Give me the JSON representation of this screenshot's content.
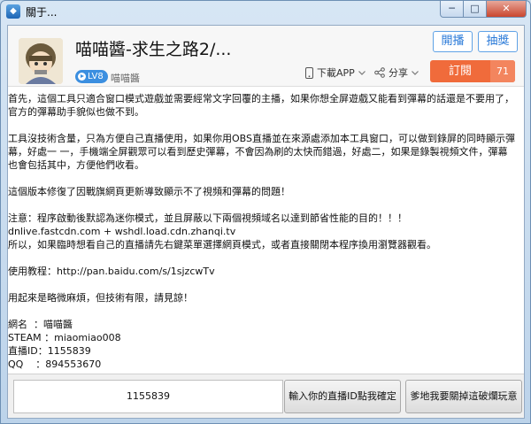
{
  "window": {
    "title": "關于...",
    "minimize_glyph": "─",
    "maximize_glyph": "□",
    "close_glyph": "✕"
  },
  "header": {
    "stream_title": "喵喵醬-求生之路2/...",
    "level_badge": "LV8",
    "streamer_name": "喵喵醬",
    "start_broadcast_label": "開播",
    "lottery_label": "抽獎",
    "download_app_label": "下載APP",
    "share_label": "分享",
    "subscribe_label": "訂閱",
    "subscribe_count": "71"
  },
  "content": {
    "paragraphs": [
      "首先，這個工具只適合窗口模式遊戲並需要經常文字回覆的主播，如果你想全屏遊戲又能看到彈幕的話還是不要用了，官方的彈幕助手貌似也做不到。",
      "工具沒技術含量，只為方便自己直播使用，如果你用OBS直播並在來源處添加本工具窗口，可以做到錄屏的同時顯示彈幕，好處一 一，手機端全屏觀眾可以看到歷史彈幕，不會因為刷的太快而錯過，好處二，如果是錄製視頻文件，彈幕也會包括其中，方便他們收看。",
      "這個版本修復了因戰旗網頁更新導致顯示不了視頻和彈幕的問題！",
      "注意：程序啟動後默認為迷你模式，並且屏蔽以下兩個視頻域名以達到節省性能的目的！！！\ndnlive.fastcdn.com + wshdl.load.cdn.zhanqi.tv\n所以，如果臨時想看自己的直播請先右鍵菜單選擇網頁模式，或者直接關閉本程序換用瀏覽器觀看。",
      "使用教程：http://pan.baidu.com/s/1sjzcwTv",
      "用起來是略微麻煩，但技術有限，請見諒！",
      "網名  ：喵喵醬\nSTEAM ：miaomiao008\n直播ID：1155839\nQQ    ：894553670"
    ]
  },
  "footer": {
    "room_id_value": "1155839",
    "confirm_button_label": "輸入你的直播ID點我確定",
    "close_button_label": "爹地我要關掉這破爛玩意"
  },
  "colors": {
    "accent": "#2a7ad8",
    "subscribe": "#f06b3b",
    "badge": "#3c8fe0"
  },
  "icons": {
    "app": "app-icon",
    "download": "phone-icon",
    "share": "share-icon",
    "chevron": "chevron-down-icon"
  }
}
